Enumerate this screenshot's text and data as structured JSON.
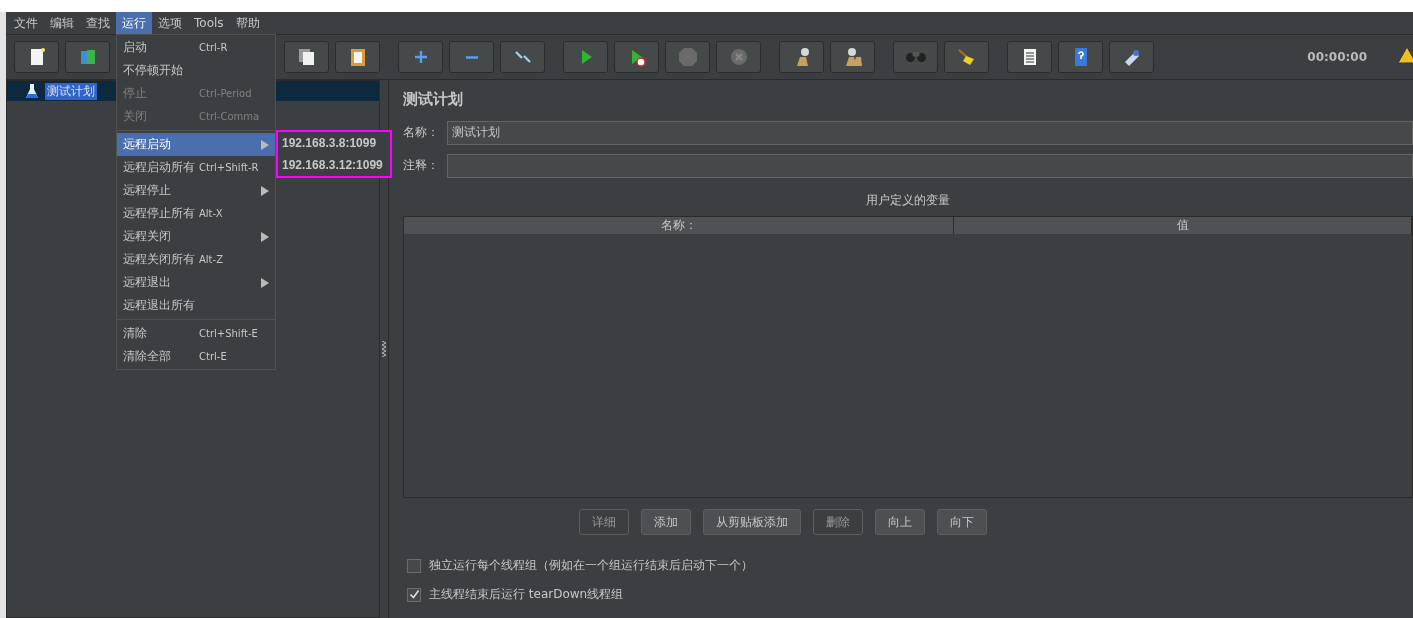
{
  "menubar": [
    {
      "label": "文件",
      "selected": false
    },
    {
      "label": "编辑",
      "selected": false
    },
    {
      "label": "查找",
      "selected": false
    },
    {
      "label": "运行",
      "selected": true
    },
    {
      "label": "选项",
      "selected": false
    },
    {
      "label": "Tools",
      "selected": false
    },
    {
      "label": "帮助",
      "selected": false
    }
  ],
  "run_menu": [
    {
      "kind": "item",
      "label": "启动",
      "shortcut": "Ctrl-R",
      "disabled": false,
      "selected": false
    },
    {
      "kind": "item",
      "label": "不停顿开始",
      "disabled": false,
      "selected": false
    },
    {
      "kind": "item",
      "label": "停止",
      "shortcut": "Ctrl-Period",
      "disabled": true,
      "selected": false
    },
    {
      "kind": "item",
      "label": "关闭",
      "shortcut": "Ctrl-Comma",
      "disabled": true,
      "selected": false
    },
    {
      "kind": "separator"
    },
    {
      "kind": "submenu",
      "label": "远程启动",
      "disabled": false,
      "selected": true
    },
    {
      "kind": "item",
      "label": "远程启动所有",
      "shortcut": "Ctrl+Shift-R",
      "disabled": false,
      "selected": false
    },
    {
      "kind": "submenu",
      "label": "远程停止",
      "disabled": false,
      "selected": false
    },
    {
      "kind": "item",
      "label": "远程停止所有",
      "shortcut": "Alt-X",
      "disabled": false,
      "selected": false
    },
    {
      "kind": "submenu",
      "label": "远程关闭",
      "disabled": false,
      "selected": false
    },
    {
      "kind": "item",
      "label": "远程关闭所有",
      "shortcut": "Alt-Z",
      "disabled": false,
      "selected": false
    },
    {
      "kind": "submenu",
      "label": "远程退出",
      "disabled": false,
      "selected": false
    },
    {
      "kind": "item",
      "label": "远程退出所有",
      "disabled": false,
      "selected": false
    },
    {
      "kind": "separator"
    },
    {
      "kind": "item",
      "label": "清除",
      "shortcut": "Ctrl+Shift-E",
      "disabled": false,
      "selected": false
    },
    {
      "kind": "item",
      "label": "清除全部",
      "shortcut": "Ctrl-E",
      "disabled": false,
      "selected": false
    }
  ],
  "remote_start_submenu": [
    {
      "label": "192.168.3.8:1099"
    },
    {
      "label": "192.168.3.12:1099"
    }
  ],
  "toolbar": {
    "timer": "00:00:00"
  },
  "tree": [
    {
      "label": "测试计划",
      "selected": true
    }
  ],
  "panel": {
    "title": "测试计划",
    "name_field": {
      "label": "名称：",
      "value": "测试计划"
    },
    "comment_field": {
      "label": "注释："
    },
    "variables": {
      "title": "用户定义的变量",
      "columns": [
        "名称：",
        "值"
      ]
    },
    "buttons": [
      {
        "label": "详细",
        "disabled": true
      },
      {
        "label": "添加",
        "disabled": false
      },
      {
        "label": "从剪贴板添加",
        "disabled": false
      },
      {
        "label": "删除",
        "disabled": true
      },
      {
        "label": "向上",
        "disabled": false
      },
      {
        "label": "向下",
        "disabled": false
      }
    ],
    "options": [
      {
        "label": "独立运行每个线程组（例如在一个组运行结束后启动下一个）",
        "checked": false
      },
      {
        "label": "主线程结束后运行 tearDown线程组",
        "checked": true
      }
    ]
  }
}
